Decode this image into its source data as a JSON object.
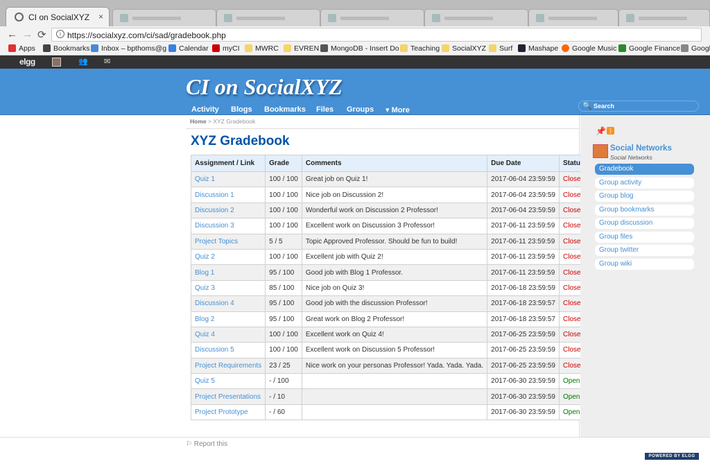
{
  "browser": {
    "tab_title": "CI on SocialXYZ",
    "tab_close": "×",
    "url": "https://socialxyz.com/ci/sad/gradebook.php",
    "back": "←",
    "forward": "→",
    "reload": "⟳",
    "info": "i",
    "bookmarks": [
      "Apps",
      "Bookmarks",
      "Inbox – bpthoms@g",
      "Calendar",
      "myCI",
      "MWRC",
      "EVREN",
      "MongoDB - Insert Do",
      "Teaching",
      "SocialXYZ",
      "Surf",
      "Mashape",
      "Google Music",
      "Google Finance",
      "Google"
    ]
  },
  "topbar": {
    "logo": "elgg",
    "friends_glyph": "👥",
    "mail_glyph": "✉"
  },
  "header": {
    "site_name": "CI on SocialXYZ",
    "menu": [
      "Activity",
      "Blogs",
      "Bookmarks",
      "Files",
      "Groups",
      "▾ More"
    ],
    "search_placeholder": "Search",
    "search_glyph": "🔍"
  },
  "page": {
    "breadcrumb_home": "Home",
    "breadcrumb_sep": ">",
    "breadcrumb_current": "XYZ Gradebook",
    "title": "XYZ Gradebook"
  },
  "gradebook": {
    "headers": [
      "Assignment / Link",
      "Grade",
      "Comments",
      "Due Date",
      "Status"
    ],
    "rows": [
      [
        "Quiz 1",
        "100 / 100",
        "Great job on Quiz 1!",
        "2017-06-04 23:59:59",
        "Closed"
      ],
      [
        "Discussion 1",
        "100 / 100",
        "Nice job on Discussion 2!",
        "2017-06-04 23:59:59",
        "Closed"
      ],
      [
        "Discussion 2",
        "100 / 100",
        "Wonderful work on Discussion 2 Professor!",
        "2017-06-04 23:59:59",
        "Closed"
      ],
      [
        "Discussion 3",
        "100 / 100",
        "Excellent work on Discussion 3 Professor!",
        "2017-06-11 23:59:59",
        "Closed"
      ],
      [
        "Project Topics",
        "5 / 5",
        "Topic Approved Professor. Should be fun to build!",
        "2017-06-11 23:59:59",
        "Closed"
      ],
      [
        "Quiz 2",
        "100 / 100",
        "Excellent job with Quiz 2!",
        "2017-06-11 23:59:59",
        "Closed"
      ],
      [
        "Blog 1",
        "95 / 100",
        "Good job with Blog 1 Professor.",
        "2017-06-11 23:59:59",
        "Closed"
      ],
      [
        "Quiz 3",
        "85 / 100",
        "Nice job on Quiz 3!",
        "2017-06-18 23:59:59",
        "Closed"
      ],
      [
        "Discussion 4",
        "95 / 100",
        "Good job with the discussion Professor!",
        "2017-06-18 23:59:57",
        "Closed"
      ],
      [
        "Blog 2",
        "95 / 100",
        "Great work on Blog 2 Professor!",
        "2017-06-18 23:59:57",
        "Closed"
      ],
      [
        "Quiz 4",
        "100 / 100",
        "Excellent work on Quiz 4!",
        "2017-06-25 23:59:59",
        "Closed"
      ],
      [
        "Discussion 5",
        "100 / 100",
        "Excellent work on Discussion 5 Professor!",
        "2017-06-25 23:59:59",
        "Closed"
      ],
      [
        "Project Requirements",
        "23 / 25",
        "Nice work on your personas Professor! Yada. Yada. Yada.",
        "2017-06-25 23:59:59",
        "Closed"
      ],
      [
        "Quiz 5",
        "- / 100",
        "",
        "2017-06-30 23:59:59",
        "Open"
      ],
      [
        "Project Presentations",
        "- / 10",
        "",
        "2017-06-30 23:59:59",
        "Open"
      ],
      [
        "Project Prototype",
        "- / 60",
        "",
        "2017-06-30 23:59:59",
        "Open"
      ]
    ]
  },
  "sidebar": {
    "pin_glyph": "📌",
    "rss_glyph": ")",
    "group_name": "Social Networks",
    "group_subtitle": "Social Networks",
    "menu": [
      "Gradebook",
      "Group activity",
      "Group blog",
      "Group bookmarks",
      "Group discussion",
      "Group files",
      "Group twitter",
      "Group wiki"
    ],
    "selected": "Gradebook"
  },
  "footer": {
    "report": "Report this",
    "report_glyph": "⚐",
    "powered_by": "POWERED BY ELGG"
  }
}
